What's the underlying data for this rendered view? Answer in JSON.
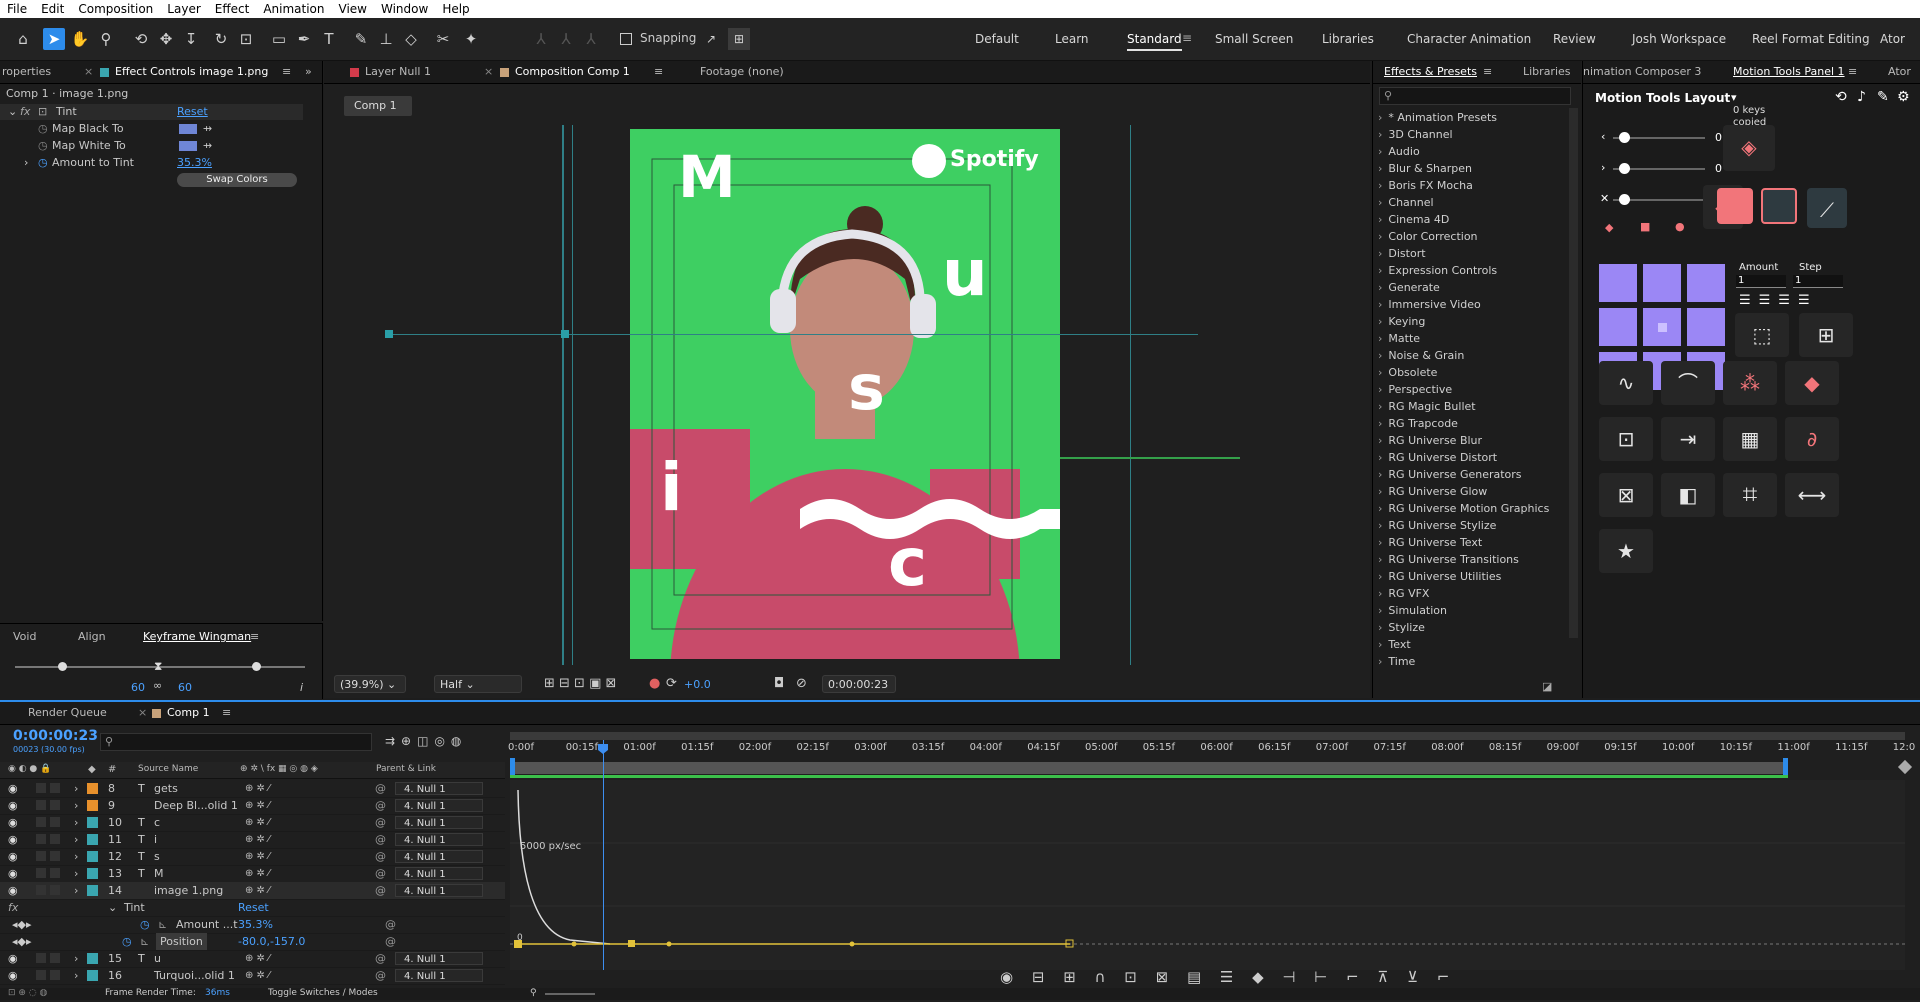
{
  "menu": [
    "File",
    "Edit",
    "Composition",
    "Layer",
    "Effect",
    "Animation",
    "View",
    "Window",
    "Help"
  ],
  "toolbar": {
    "snapping_label": "Snapping",
    "workspaces": [
      "Default",
      "Learn",
      "Standard",
      "Small Screen",
      "Libraries",
      "Character Animation",
      "Review",
      "Josh Workspace",
      "Reel Format Editing",
      "Ator"
    ],
    "selected_workspace": "Standard"
  },
  "effect_controls": {
    "tab_left": "roperties",
    "tab_title": "Effect Controls image 1.png",
    "layer_path": "Comp 1 · image 1.png",
    "effect_name": "Tint",
    "reset_label": "Reset",
    "props": [
      {
        "label": "Map Black To",
        "color": "#6f86d6"
      },
      {
        "label": "Map White To",
        "color": "#6f86d6"
      },
      {
        "label": "Amount to Tint",
        "value": "35.3%"
      }
    ],
    "swap_button": "Swap Colors"
  },
  "keyframe_wingman": {
    "tabs": [
      "Void",
      "Align",
      "Keyframe Wingman"
    ],
    "left_value": "60",
    "right_value": "60",
    "link_icon": "∞",
    "info": "i"
  },
  "viewer": {
    "tabs": [
      "Layer Null 1",
      "Composition Comp 1",
      "Footage (none)"
    ],
    "breadcrumb": "Comp 1",
    "zoom": "(39.9%)",
    "resolution": "Half",
    "exposure": "+0.0",
    "timecode": "0:00:00:23",
    "artwork": {
      "brand": "Spotify",
      "letters": [
        "M",
        "u",
        "s",
        "i",
        "c"
      ],
      "bg_color": "#3ecf62",
      "sweater_color": "#c84b6a"
    }
  },
  "effects_presets": {
    "tab": "Effects & Presets",
    "tab2": "Libraries",
    "search_placeholder": "",
    "items": [
      "* Animation Presets",
      "3D Channel",
      "Audio",
      "Blur & Sharpen",
      "Boris FX Mocha",
      "Channel",
      "Cinema 4D",
      "Color Correction",
      "Distort",
      "Expression Controls",
      "Generate",
      "Immersive Video",
      "Keying",
      "Matte",
      "Noise & Grain",
      "Obsolete",
      "Perspective",
      "RG Magic Bullet",
      "RG Trapcode",
      "RG Universe Blur",
      "RG Universe Distort",
      "RG Universe Generators",
      "RG Universe Glow",
      "RG Universe Motion Graphics",
      "RG Universe Stylize",
      "RG Universe Text",
      "RG Universe Transitions",
      "RG Universe Utilities",
      "RG VFX",
      "Simulation",
      "Stylize",
      "Text",
      "Time"
    ]
  },
  "motion_tools": {
    "tab_left": "nimation Composer 3",
    "tab_title": "Motion Tools Panel 1",
    "tab_right": "Ator",
    "layout_label": "Motion Tools Layout",
    "status_line1": "0 keys",
    "status_line2": "copied",
    "sliders": [
      {
        "value": "0"
      },
      {
        "value": "0"
      },
      {
        "value": "0"
      }
    ],
    "amount_label": "Amount",
    "step_label": "Step",
    "amount_value": "1",
    "step_value": "1",
    "grid_color": "#9b87f5",
    "accent_color": "#f2757a"
  },
  "timeline": {
    "tabs": [
      "Render Queue",
      "Comp 1"
    ],
    "timecode": "0:00:00:23",
    "fps_info": "00023 (30.00 fps)",
    "column_headers": {
      "num": "#",
      "source": "Source Name",
      "parent": "Parent & Link"
    },
    "layers": [
      {
        "num": "8",
        "type": "T",
        "name": "gets",
        "color": "#e8912c",
        "parent": "4. Null 1"
      },
      {
        "num": "9",
        "type": "",
        "name": "Deep Bl...olid 1",
        "color": "#e8912c",
        "parent": "4. Null 1"
      },
      {
        "num": "10",
        "type": "T",
        "name": "c",
        "color": "#3aa6b0",
        "parent": "4. Null 1"
      },
      {
        "num": "11",
        "type": "T",
        "name": "i",
        "color": "#3aa6b0",
        "parent": "4. Null 1"
      },
      {
        "num": "12",
        "type": "T",
        "name": "s",
        "color": "#3aa6b0",
        "parent": "4. Null 1"
      },
      {
        "num": "13",
        "type": "T",
        "name": "M",
        "color": "#3aa6b0",
        "parent": "4. Null 1"
      },
      {
        "num": "14",
        "type": "",
        "name": "image 1.png",
        "color": "#3aa6b0",
        "parent": "4. Null 1"
      }
    ],
    "tint_label": "Tint",
    "tint_reset": "Reset",
    "amount_label": "Amount ...t",
    "amount_value": "35.3%",
    "position_label": "Position",
    "position_value": "-80.0,-157.0",
    "layers_after": [
      {
        "num": "15",
        "type": "T",
        "name": "u",
        "color": "#3aa6b0",
        "parent": "4. Null 1"
      },
      {
        "num": "16",
        "type": "",
        "name": "Turquoi...olid 1",
        "color": "#3aa6b0",
        "parent": "4. Null 1"
      }
    ],
    "ruler": [
      "0:00f",
      "00:15f",
      "01:00f",
      "01:15f",
      "02:00f",
      "02:15f",
      "03:00f",
      "03:15f",
      "04:00f",
      "04:15f",
      "05:00f",
      "05:15f",
      "06:00f",
      "06:15f",
      "07:00f",
      "07:15f",
      "08:00f",
      "08:15f",
      "09:00f",
      "09:15f",
      "10:00f",
      "10:15f",
      "11:00f",
      "11:15f",
      "12:0"
    ],
    "graph_label": "5000 px/sec",
    "graph_zero": "0",
    "footer_render": "Frame Render Time:",
    "footer_render_value": "36ms",
    "footer_toggle": "Toggle Switches / Modes"
  }
}
